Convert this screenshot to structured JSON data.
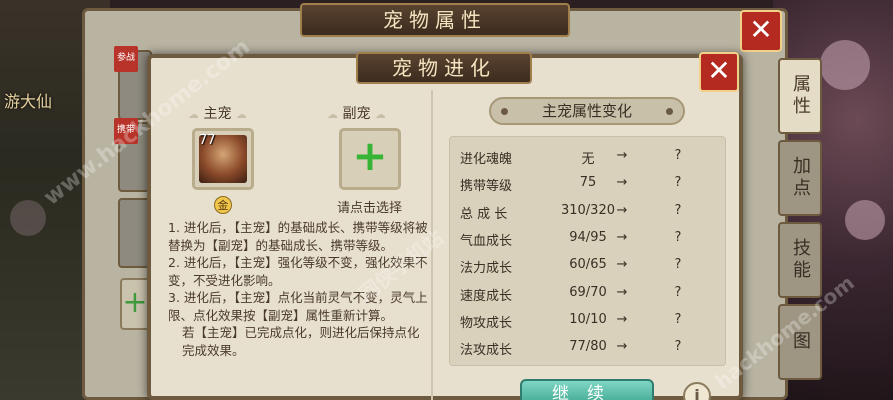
{
  "background": {
    "game_name": "游大仙"
  },
  "back_panel": {
    "title": "宠物属性",
    "close_glyph": "✕",
    "tag_labels": [
      "参战",
      "携带"
    ]
  },
  "side_tabs": [
    {
      "label": "属性"
    },
    {
      "label": "加点"
    },
    {
      "label": "技能"
    },
    {
      "label": "图"
    }
  ],
  "dialog": {
    "title": "宠物进化",
    "close_glyph": "✕",
    "main_pet": {
      "label": "主宠",
      "level": "77",
      "grade": "金"
    },
    "sub_pet": {
      "label": "副宠",
      "hint": "请点击选择"
    },
    "rules": [
      "1. 进化后，【主宠】的基础成长、携带等级将被替换为【副宠】的基础成长、携带等级。",
      "2. 进化后，【主宠】强化等级不变，强化效果不变，不受进化影响。",
      "3. 进化后，【主宠】点化当前灵气不变，灵气上限、点化效果按【副宠】属性重新计算。",
      "若【主宠】已完成点化，则进化后保持点化完成效果。"
    ],
    "stats_header": "主宠属性变化",
    "stats": [
      {
        "name": "进化魂魄",
        "value": "无",
        "arrow": "→",
        "result": "?"
      },
      {
        "name": "携带等级",
        "value": "75",
        "arrow": "→",
        "result": "?"
      },
      {
        "name": "总 成 长",
        "value": "310/320",
        "arrow": "→",
        "result": "?"
      },
      {
        "name": "气血成长",
        "value": "94/95",
        "arrow": "→",
        "result": "?"
      },
      {
        "name": "法力成长",
        "value": "60/65",
        "arrow": "→",
        "result": "?"
      },
      {
        "name": "速度成长",
        "value": "69/70",
        "arrow": "→",
        "result": "?"
      },
      {
        "name": "物攻成长",
        "value": "10/10",
        "arrow": "→",
        "result": "?"
      },
      {
        "name": "法攻成长",
        "value": "77/80",
        "arrow": "→",
        "result": "?"
      }
    ],
    "continue_label": "继续",
    "info_glyph": "i"
  },
  "watermarks": [
    "www.hackhome.com",
    "网侠手机站",
    "hackhome.com"
  ],
  "colors": {
    "accent_red": "#b42a20",
    "button_teal": "#3aa38c",
    "plus_green": "#37b336",
    "panel_bg": "#e7e0ce"
  }
}
